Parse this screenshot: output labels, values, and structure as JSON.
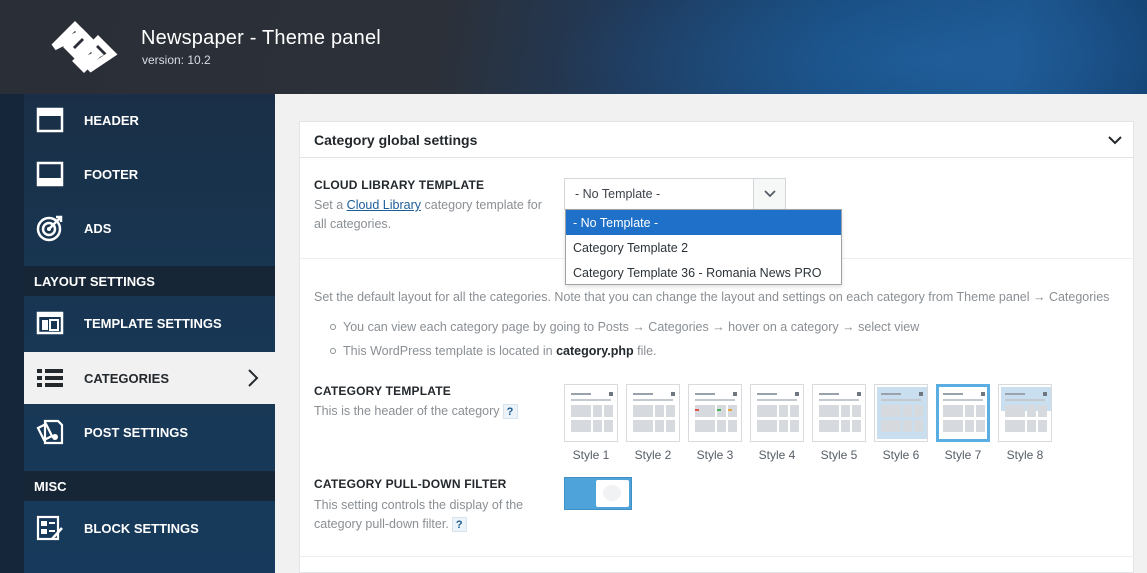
{
  "app": {
    "title": "Newspaper - Theme panel",
    "version": "version: 10.2"
  },
  "sidebar": {
    "items": [
      {
        "label": "HEADER",
        "icon": "header-icon"
      },
      {
        "label": "FOOTER",
        "icon": "footer-icon"
      },
      {
        "label": "ADS",
        "icon": "target-icon"
      },
      {
        "label": "TEMPLATE SETTINGS",
        "icon": "template-icon"
      },
      {
        "label": "CATEGORIES",
        "icon": "list-icon"
      },
      {
        "label": "POST SETTINGS",
        "icon": "post-icon"
      },
      {
        "label": "BLOCK SETTINGS",
        "icon": "block-icon"
      }
    ],
    "headings": {
      "layout": "LAYOUT SETTINGS",
      "misc": "MISC"
    },
    "active_item": "CATEGORIES"
  },
  "panel": {
    "title": "Category global settings",
    "cloud_library": {
      "title": "CLOUD LIBRARY TEMPLATE",
      "desc_prefix": "Set a ",
      "desc_link": "Cloud Library",
      "desc_suffix": " category template for all categories.",
      "selected_value": "- No Template -",
      "options": [
        "- No Template -",
        "Category Template 2",
        "Category Template 36 - Romania News PRO"
      ]
    },
    "layout_desc": "Set the default layout for all the categories. Note that you can change the layout and settings on each category from Theme panel → Categories",
    "bullet1": "You can view each category page by going to Posts → Categories → hover on a category → select view",
    "bullet2_prefix": "This WordPress template is located in ",
    "bullet2_file": "category.php",
    "bullet2_suffix": " file.",
    "category_template": {
      "title": "CATEGORY TEMPLATE",
      "desc": "This is the header of the category",
      "help": "?",
      "styles": [
        "Style 1",
        "Style 2",
        "Style 3",
        "Style 4",
        "Style 5",
        "Style 6",
        "Style 7",
        "Style 8"
      ],
      "selected_style": "Style 7"
    },
    "pulldown_filter": {
      "title": "CATEGORY PULL-DOWN FILTER",
      "desc": "This setting controls the display of the category pull-down filter.",
      "help": "?",
      "enabled": true
    }
  },
  "colors": {
    "accent": "#4ea3da",
    "selected_option": "#1e70c8",
    "sidebar_bg": "#183652",
    "active_bg": "#f1f1f1"
  }
}
